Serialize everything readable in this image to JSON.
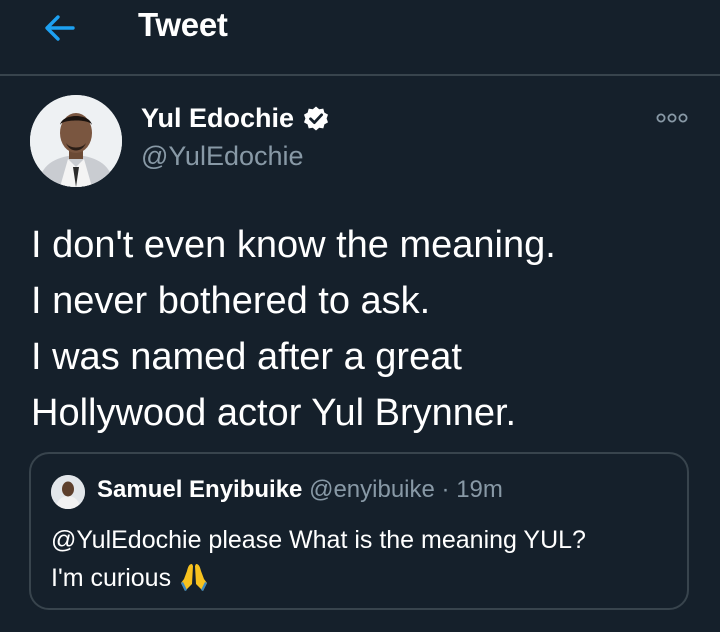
{
  "header": {
    "title": "Tweet",
    "back_icon": "arrow-left-icon",
    "accent": "#1da1f2"
  },
  "tweet": {
    "author": {
      "name": "Yul Edochie",
      "handle": "@YulEdochie",
      "verified": true
    },
    "text": "I don't even know the meaning.\nI never bothered to ask.\nI was named after a great\nHollywood actor Yul Brynner.",
    "more_icon": "more-options-icon"
  },
  "quoted_tweet": {
    "author_name": "Samuel Enyibuike",
    "handle": "@enyibuike",
    "separator": "·",
    "time": "19m",
    "text": "@YulEdochie please What is the meaning YUL?\nI'm curious",
    "emoji": "folded-hands-emoji"
  },
  "colors": {
    "background": "#15202b",
    "border": "#38444d",
    "secondary_text": "#8899a6",
    "verified": "#ffffff"
  }
}
